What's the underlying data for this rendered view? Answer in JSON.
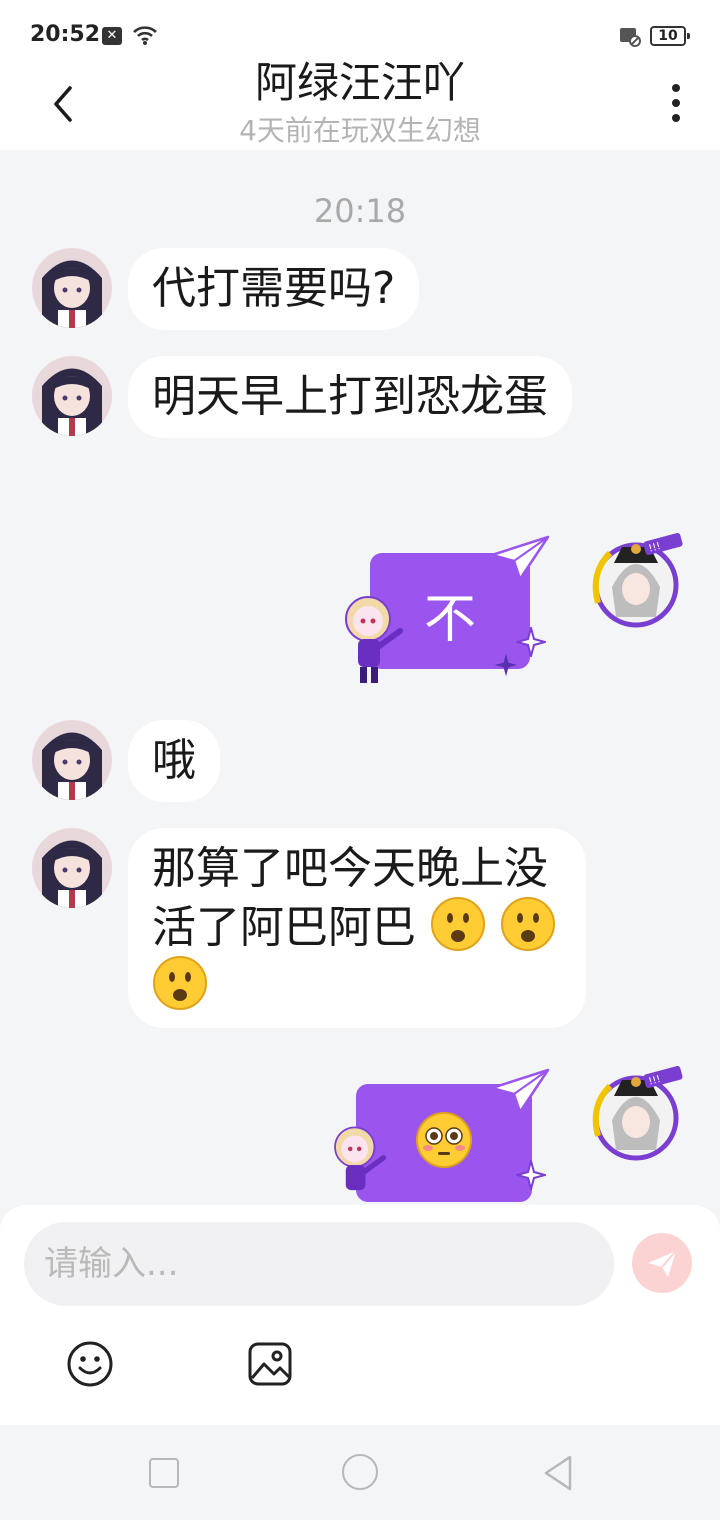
{
  "status_bar": {
    "time": "20:52",
    "notification_icon": "x-icon",
    "wifi_icon": "wifi-icon",
    "sim_icon": "sim-card-icon",
    "battery": "10"
  },
  "header": {
    "title": "阿绿汪汪吖",
    "subtitle": "4天前在玩双生幻想",
    "back_icon": "chevron-left-icon",
    "more_icon": "more-vertical-icon"
  },
  "chat": {
    "timestamp": "20:18",
    "messages": [
      {
        "side": "left",
        "text": "代打需要吗?"
      },
      {
        "side": "left",
        "text": "明天早上打到恐龙蛋"
      },
      {
        "side": "right",
        "type": "sticker",
        "text": "不"
      },
      {
        "side": "left",
        "text": "哦"
      },
      {
        "side": "left",
        "text": "那算了吧今天晚上没活了阿巴阿巴",
        "emoji": [
          "frowning-face-open-mouth",
          "frowning-face-open-mouth",
          "frowning-face-open-mouth"
        ]
      },
      {
        "side": "right",
        "type": "sticker",
        "emoji": "flushed-face"
      }
    ]
  },
  "composer": {
    "placeholder": "请输入...",
    "send_icon": "send-paper-plane-icon",
    "emoji_icon": "smiley-icon",
    "image_icon": "image-icon"
  },
  "colors": {
    "sticker_purple": "#9a55ee",
    "send_button": "#fbd3d3",
    "background": "#f4f5f7"
  }
}
